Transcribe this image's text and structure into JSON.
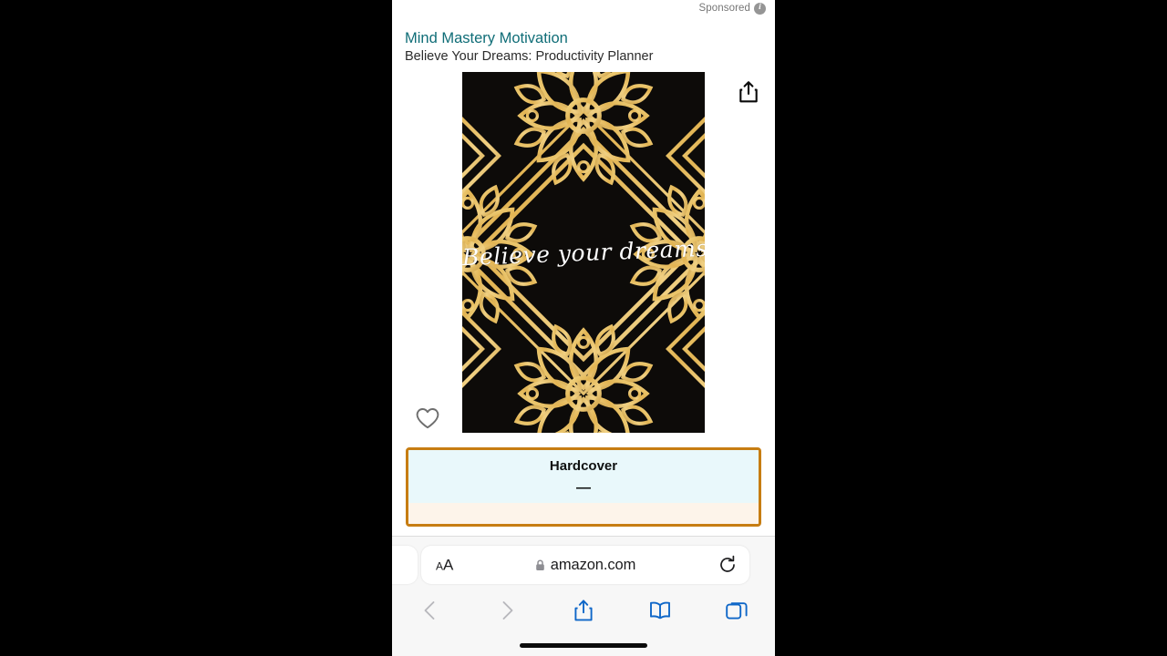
{
  "page": {
    "sponsored_label": "Sponsored",
    "info_icon": "info-circle-icon"
  },
  "product": {
    "brand": "Mind Mastery Motivation",
    "subtitle": "Believe Your Dreams: Productivity Planner",
    "cover": {
      "script_text": "Believe your dreams",
      "background_color": "#0d0b09",
      "accent_color": "#e8b94e",
      "style": "gold art-deco mandala floral pattern on black"
    },
    "share_icon": "share-icon",
    "wishlist_icon": "heart-outline-icon"
  },
  "format_selector": {
    "label": "Hardcover",
    "price": "—",
    "selected": true,
    "border_color": "#c77d12",
    "top_bg": "#e9f8fb",
    "bottom_bg": "#fdf4ea"
  },
  "browser": {
    "url": "amazon.com",
    "lock_icon": "lock-icon",
    "text_size_small": "A",
    "text_size_large": "A",
    "reload_icon": "reload-icon",
    "toolbar": [
      {
        "name": "back-button",
        "icon": "chevron-left-icon",
        "enabled": false
      },
      {
        "name": "forward-button",
        "icon": "chevron-right-icon",
        "enabled": false
      },
      {
        "name": "share-button",
        "icon": "share-icon",
        "enabled": true
      },
      {
        "name": "bookmarks-button",
        "icon": "book-icon",
        "enabled": true
      },
      {
        "name": "tabs-button",
        "icon": "tabs-icon",
        "enabled": true
      }
    ],
    "accent_color": "#0f67c8",
    "disabled_color": "#b8b8bd"
  }
}
